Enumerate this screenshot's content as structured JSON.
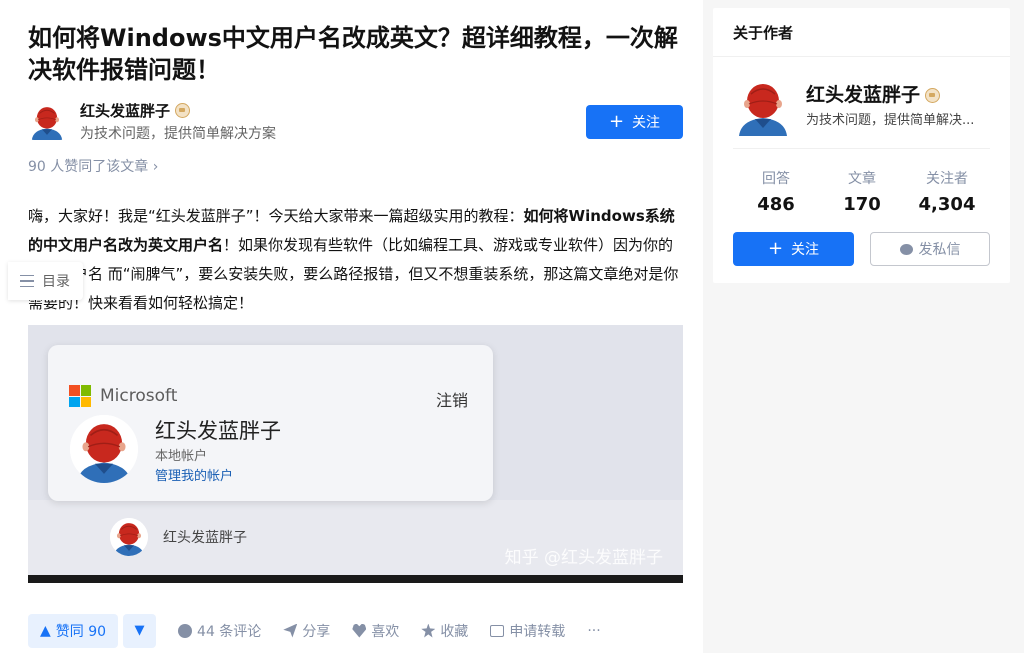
{
  "article": {
    "title": "如何将Windows中文用户名改成英文？超详细教程，一次解决软件报错问题！",
    "likes_line": "90 人赞同了该文章 ›",
    "intro_1": "嗨，大家好！我是“红头发蓝胖子”！今天给大家带来一篇超级实用的教程：",
    "intro_bold": "如何将Windows系统的中文用户名改为英文用户名",
    "intro_2": "！如果你发现有些软件（比如编程工具、游戏或专业软件）因为你的中文用户名 而“闹脾气”，要么安装失败，要么路径报错，但又不想重装系统，那这篇文章绝对是你需要的！快来看看如何轻松搞定！"
  },
  "author": {
    "name": "红头发蓝胖子",
    "desc": "为技术问题，提供简单解决方案",
    "follow_label": "关注"
  },
  "toc": {
    "label": "目录"
  },
  "figure": {
    "brand": "Microsoft",
    "signout": "注销",
    "account_name": "红头发蓝胖子",
    "account_type": "本地帐户",
    "manage_link": "管理我的帐户",
    "mini_name": "红头发蓝胖子",
    "watermark": "知乎 @红头发蓝胖子",
    "ms_colors": [
      "#f25022",
      "#7fba00",
      "#00a4ef",
      "#ffb900"
    ]
  },
  "actions": {
    "upvote": "赞同 90",
    "comments": "44 条评论",
    "share": "分享",
    "like": "喜欢",
    "collect": "收藏",
    "repost": "申请转载",
    "more": "···"
  },
  "sidebar": {
    "heading": "关于作者",
    "name": "红头发蓝胖子",
    "desc": "为技术问题，提供简单解决...",
    "stats": [
      {
        "label": "回答",
        "value": "486"
      },
      {
        "label": "文章",
        "value": "170"
      },
      {
        "label": "关注者",
        "value": "4,304"
      }
    ],
    "follow_label": "关注",
    "message_label": "发私信"
  },
  "colors": {
    "accent": "#1772f6",
    "muted": "#8590a6"
  }
}
